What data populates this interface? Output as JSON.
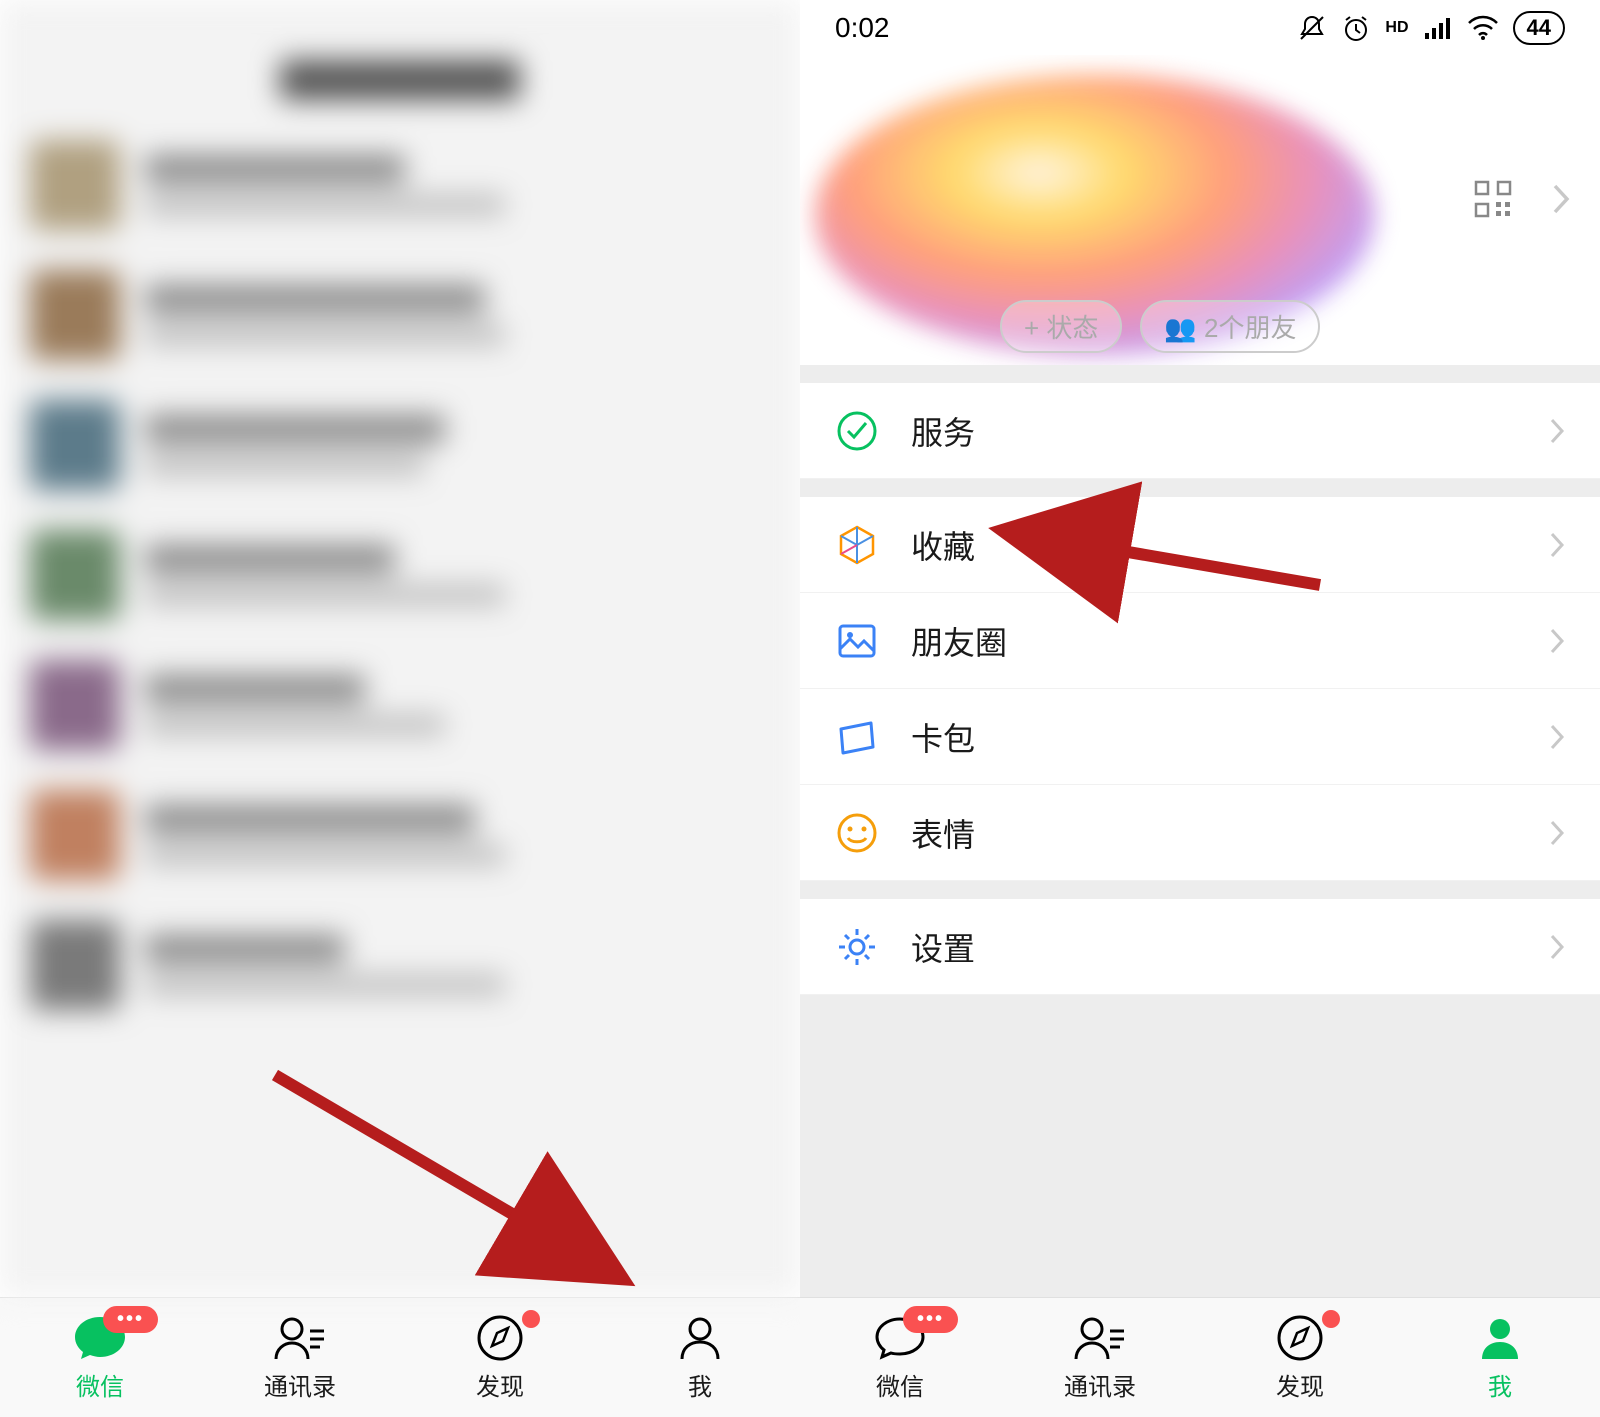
{
  "status": {
    "time": "0:02",
    "battery": "44"
  },
  "profile": {
    "statusChip": "+ 状态",
    "friendsChip": "👥 2个朋友"
  },
  "menu": {
    "services": "服务",
    "favorites": "收藏",
    "moments": "朋友圈",
    "cards": "卡包",
    "stickers": "表情",
    "settings": "设置"
  },
  "tabs": {
    "chats": "微信",
    "contacts": "通讯录",
    "discover": "发现",
    "me": "我"
  },
  "badge": {
    "dots": "•••"
  }
}
